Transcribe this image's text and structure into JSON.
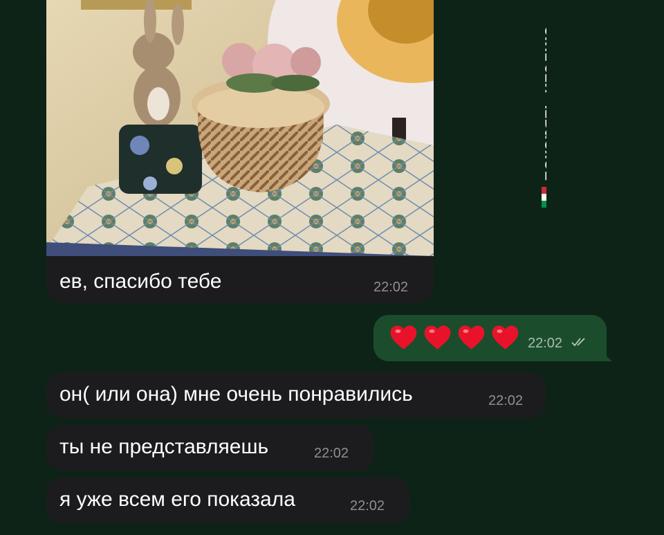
{
  "messages": [
    {
      "id": "m1",
      "type": "photo",
      "text": "ев, спасибо тебе",
      "time": "22:02"
    },
    {
      "id": "m2",
      "type": "outgoing",
      "emoji": "❤️❤️❤️❤️",
      "time": "22:02",
      "status": "read-double-check"
    },
    {
      "id": "m3",
      "type": "incoming",
      "text": "он( или она) мне очень понравились",
      "time": "22:02"
    },
    {
      "id": "m4",
      "type": "incoming",
      "text": "ты не представляешь",
      "time": "22:02"
    },
    {
      "id": "m5",
      "type": "incoming",
      "text": "я уже всем его показала",
      "time": "22:02"
    }
  ],
  "side_banner": {
    "text": "покорять италию",
    "icon": "italy-flag-icon"
  },
  "colors": {
    "background": "#0e2318",
    "incoming_bubble": "#1c1c1e",
    "outgoing_bubble": "#1b4d2d",
    "heart": "#e8132a"
  }
}
